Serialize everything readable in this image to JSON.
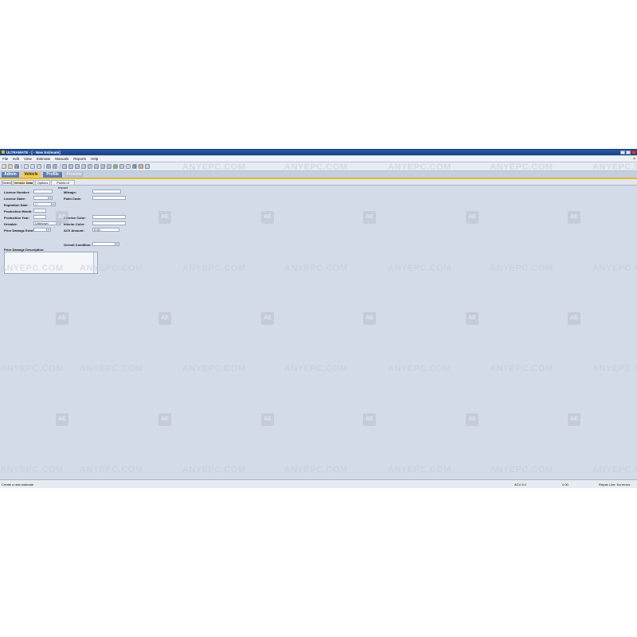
{
  "window": {
    "title": "ULTRAMATE - [ - New Estimate]"
  },
  "menu": [
    "File",
    "Edit",
    "View",
    "Estimate",
    "Manuals",
    "Reports",
    "Help"
  ],
  "primary_tabs": [
    {
      "label": "Admin",
      "state": "normal"
    },
    {
      "label": "Vehicle",
      "state": "active"
    },
    {
      "label": "Profile",
      "state": "normal"
    },
    {
      "label": "Preview",
      "state": "disabled"
    }
  ],
  "secondary_tabs": [
    {
      "label": "Select",
      "state": "normal"
    },
    {
      "label": "Vehicle Data",
      "state": "active"
    },
    {
      "label": "Options",
      "state": "normal"
    },
    {
      "label": "Points of Impact",
      "state": "normal"
    }
  ],
  "form": {
    "license_number": {
      "label": "License Number:",
      "value": ""
    },
    "license_state": {
      "label": "License State:",
      "value": ""
    },
    "expiration_date": {
      "label": "Expiration Date:",
      "value": " / / "
    },
    "production_month": {
      "label": "Production Month:",
      "value": ""
    },
    "production_year": {
      "label": "Production Year:",
      "value": ""
    },
    "drivable": {
      "label": "Drivable:",
      "value": "Unknown"
    },
    "prior_damage_exists": {
      "label": "Prior Damage Exists:",
      "value": ""
    },
    "mileage": {
      "label": "Mileage:",
      "value": ""
    },
    "paint_code": {
      "label": "Paint Code:",
      "value": ""
    },
    "exterior_color": {
      "label": "Exterior Color:",
      "value": ""
    },
    "interior_color": {
      "label": "Interior Color:",
      "value": ""
    },
    "acv_amount": {
      "label": "ACV Amount:",
      "value": "0.00"
    },
    "overall_condition": {
      "label": "Overall Condition:",
      "value": ""
    },
    "prior_damage_description": {
      "label": "Prior Damage Description:",
      "value": ""
    }
  },
  "status": {
    "message": "Create a new estimate",
    "version": "ACV 5.0",
    "amount": "0.00",
    "repair_line": "Repair Line: No errors"
  },
  "watermark": {
    "text": "ANYEPC.COM",
    "logo": "AE"
  },
  "colors": {
    "titlebar": "#1f4b8e",
    "active_tab": "#f2c94c",
    "window_bg": "#d3dbe8"
  }
}
